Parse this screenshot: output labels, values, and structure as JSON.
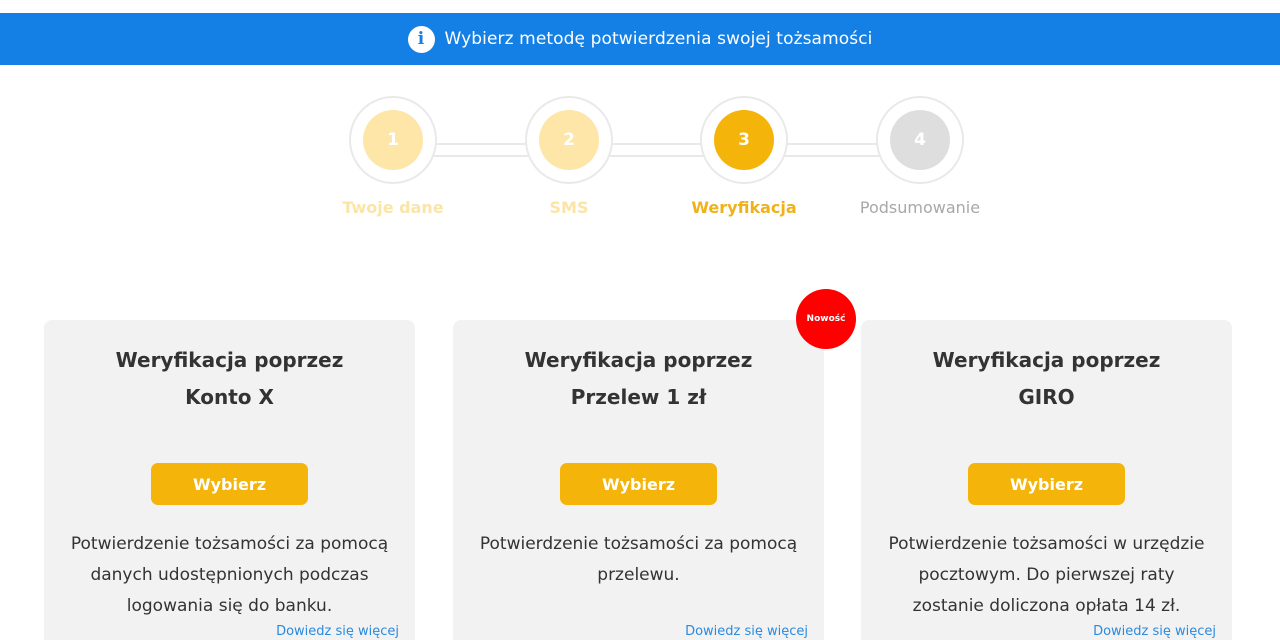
{
  "banner": {
    "icon": "info-icon",
    "text": "Wybierz metodę potwierdzenia swojej tożsamości"
  },
  "stepper": {
    "steps": [
      {
        "number": "1",
        "label": "Twoje dane",
        "state": "done"
      },
      {
        "number": "2",
        "label": "SMS",
        "state": "done"
      },
      {
        "number": "3",
        "label": "Weryfikacja",
        "state": "active"
      },
      {
        "number": "4",
        "label": "Podsumowanie",
        "state": "pending"
      }
    ]
  },
  "cards": [
    {
      "title_line1": "Weryfikacja poprzez",
      "title_line2": "Konto X",
      "button": "Wybierz",
      "description": "Potwierdzenie tożsamości za pomocą danych udostępnionych podczas logowania się do banku.",
      "link": "Dowiedz się więcej"
    },
    {
      "title_line1": "Weryfikacja poprzez",
      "title_line2": "Przelew 1 zł",
      "button": "Wybierz",
      "description": "Potwierdzenie tożsamości za pomocą przelewu.",
      "link": "Dowiedz się więcej",
      "badge": "Nowość"
    },
    {
      "title_line1": "Weryfikacja poprzez",
      "title_line2": "GIRO",
      "button": "Wybierz",
      "description": "Potwierdzenie tożsamości w urzędzie pocztowym. Do pierwszej raty zostanie doliczona opłata 14 zł.",
      "link": "Dowiedz się więcej"
    }
  ],
  "colors": {
    "banner": "#1480e6",
    "accent": "#f5b40a",
    "done_circle": "#fde6a8",
    "done_label": "#fbe5a6",
    "pending_circle": "#dedede",
    "pending_label": "#a8a8a8",
    "badge": "#ff0000",
    "link": "#2a8ae0"
  }
}
